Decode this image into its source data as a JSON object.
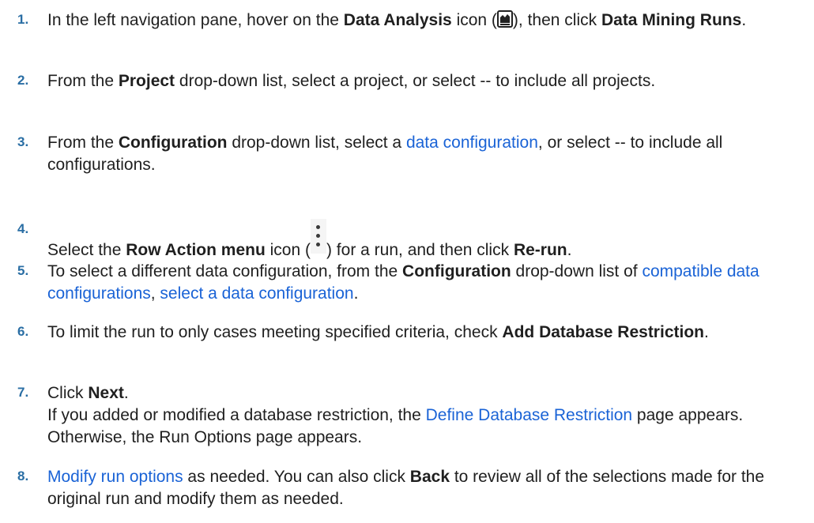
{
  "steps": [
    {
      "number": "1.",
      "t1": "In the left navigation pane, hover on the ",
      "b1": "Data Analysis",
      "t2": " icon (",
      "icon": "data-analysis-icon",
      "t3": "), then click ",
      "b2": "Data Mining Runs",
      "t4": "."
    },
    {
      "number": "2.",
      "t1": "From the ",
      "b1": "Project",
      "t2": " drop-down list, select a project, or select -- to include all projects."
    },
    {
      "number": "3.",
      "t1": "From the ",
      "b1": "Configuration",
      "t2": " drop-down list, select a ",
      "link1": "data configuration",
      "t3": ", or select -- to include all configurations."
    },
    {
      "number": "4.",
      "t1": "Select the ",
      "b1": "Row Action menu",
      "t2": " icon (",
      "icon": "row-action-menu-icon",
      "t3": ") for a run, and then click ",
      "b2": "Re-run",
      "t4": "."
    },
    {
      "number": "5.",
      "t1": "To select a different data configuration, from the ",
      "b1": "Configuration",
      "t2": " drop-down list of ",
      "link1": "compatible data configurations",
      "t3": ", ",
      "link2": "select a data configuration",
      "t4": "."
    },
    {
      "number": "6.",
      "t1": "To limit the run to only cases meeting specified criteria, check ",
      "b1": "Add Database Restriction",
      "t2": "."
    },
    {
      "number": "7.",
      "t1": "Click ",
      "b1": "Next",
      "t2": ".",
      "t3": "If you added or modified a database restriction, the ",
      "link1": "Define Database Restriction",
      "t4": " page appears. Otherwise, the Run Options page appears."
    },
    {
      "number": "8.",
      "link1": "Modify run options",
      "t1": " as needed. You can also click ",
      "b1": "Back",
      "t2": " to review all of the selections made for the original run and modify them as needed."
    }
  ],
  "colors": {
    "number": "#2a6ea4",
    "link": "#1a63d6",
    "text": "#1f1f1f"
  }
}
